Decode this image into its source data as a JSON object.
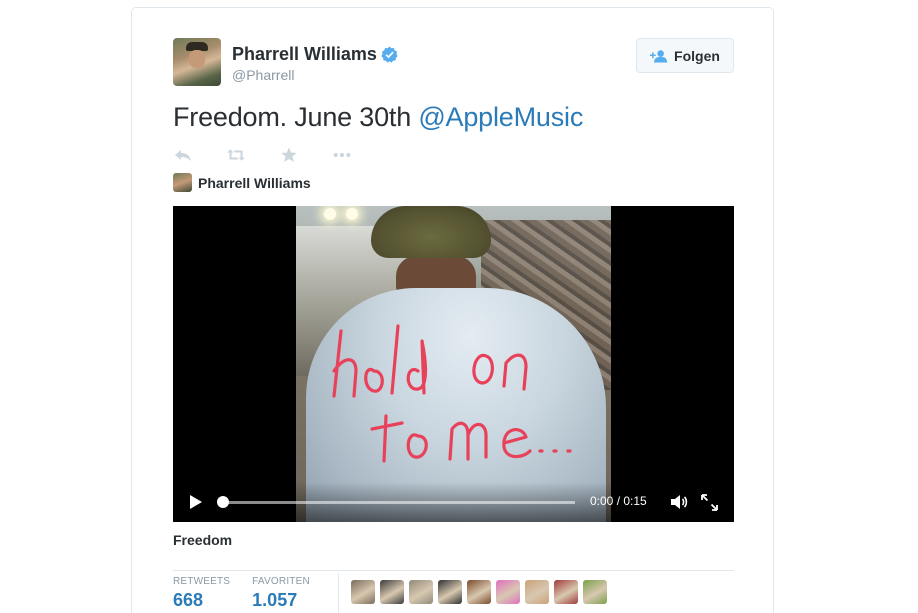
{
  "tweet": {
    "author_name": "Pharrell Williams",
    "handle": "@Pharrell",
    "follow_label": "Folgen",
    "text_plain": "Freedom. June 30th ",
    "text_mention": "@AppleMusic",
    "verified_icon": "verified-badge-icon",
    "accent_color": "#2b7bb9"
  },
  "actions": {
    "reply_icon": "reply-icon",
    "retweet_icon": "retweet-icon",
    "favorite_icon": "star-icon",
    "more_icon": "more-dots-icon"
  },
  "card": {
    "author_name": "Pharrell Williams",
    "title": "Freedom",
    "video": {
      "time_display": "0:00 / 0:15",
      "progress_fraction": 0.0,
      "play_icon": "play-icon",
      "volume_icon": "volume-icon",
      "fullscreen_icon": "expand-icon"
    }
  },
  "stats": {
    "retweets_label": "RETWEETS",
    "retweets_value": "668",
    "favorites_label": "FAVORITEN",
    "favorites_value": "1.057"
  },
  "favoriters": [
    {
      "name": "user-avatar-1",
      "color": "#7a6a5a"
    },
    {
      "name": "user-avatar-2",
      "color": "#3a3a3a"
    },
    {
      "name": "user-avatar-3",
      "color": "#8f8a7a"
    },
    {
      "name": "user-avatar-4",
      "color": "#2f2f2f"
    },
    {
      "name": "user-avatar-5",
      "color": "#7b4a2a"
    },
    {
      "name": "user-avatar-6",
      "color": "#e070c0"
    },
    {
      "name": "user-avatar-7",
      "color": "#c9a27a"
    },
    {
      "name": "user-avatar-8",
      "color": "#a03a3a"
    },
    {
      "name": "user-avatar-9",
      "color": "#7aa04a"
    }
  ]
}
